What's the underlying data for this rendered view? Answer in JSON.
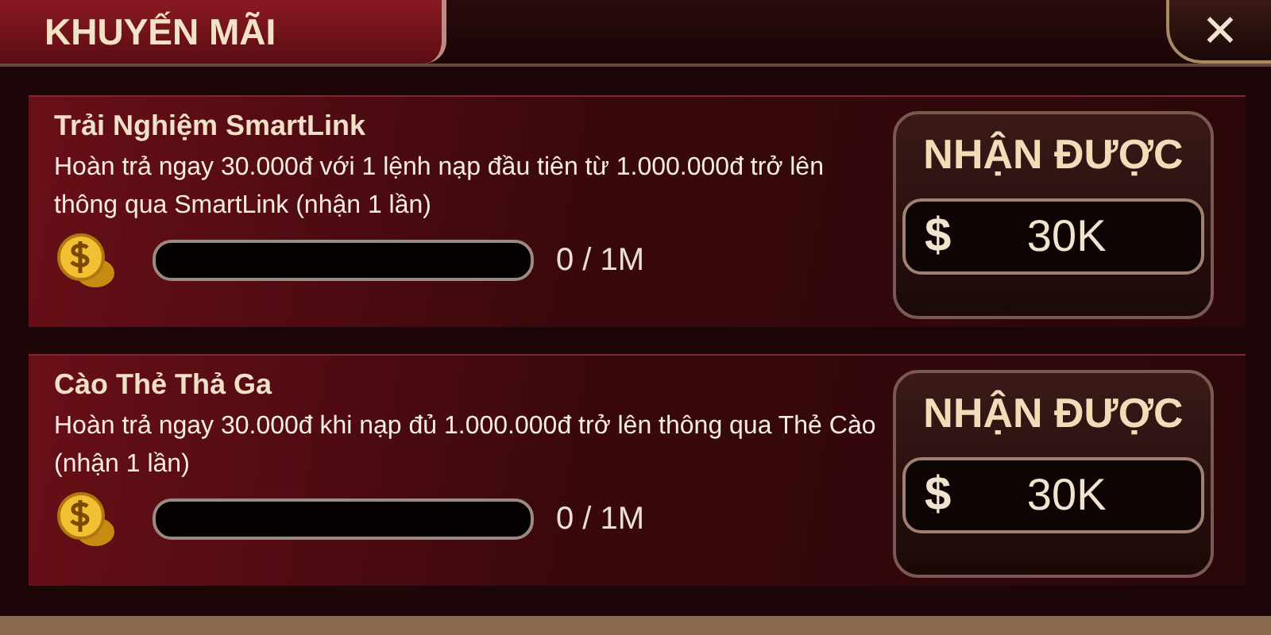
{
  "header": {
    "tab": {
      "label": "KHUYẾN MÃI",
      "selected": true
    },
    "close": "✕"
  },
  "promotions": [
    {
      "title": "Trải Nghiệm SmartLink",
      "description": "Hoàn trả ngay 30.000đ với 1 lệnh nạp đầu tiên từ 1.000.000đ trở lên thông qua SmartLink (nhận 1 lần)",
      "level": 0,
      "progress": "0 / 1M",
      "reward_label": "NHẬN ĐƯỢC",
      "currency": "$",
      "reward": "30K"
    },
    {
      "title": "Cào Thẻ Thả Ga",
      "description": "Hoàn trả ngay 30.000đ khi nạp đủ 1.000.000đ trở lên thông qua Thẻ Cào (nhận 1 lần)",
      "level": 0,
      "progress": "0 / 1M",
      "reward_label": "NHẬN ĐƯỢC",
      "currency": "$",
      "reward": "30K"
    }
  ]
}
